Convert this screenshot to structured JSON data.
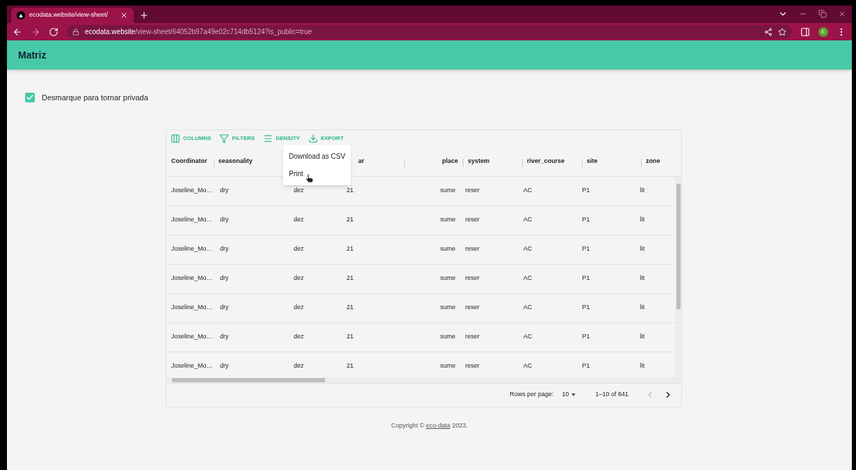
{
  "browser": {
    "tab_title": "ecodata.website/view-sheet/",
    "url_host": "ecodata.website",
    "url_path": "/view-sheet/64052b97a49e02c714db5124?is_public=true",
    "avatar": "E"
  },
  "app_bar": {
    "title": "Matriz"
  },
  "public_checkbox": {
    "label": "Desmarque para tornar privada",
    "checked": true
  },
  "toolbar": [
    {
      "kind": "columns",
      "label": "COLUMNS"
    },
    {
      "kind": "filters",
      "label": "FILTERS"
    },
    {
      "kind": "density",
      "label": "DENSITY"
    },
    {
      "kind": "export",
      "label": "EXPORT"
    }
  ],
  "table": {
    "columns": [
      {
        "label": "Coordinator",
        "kind": "leading"
      },
      {
        "label": "seasonality",
        "kind": "leading"
      },
      {
        "kind": "leading"
      },
      {
        "label": "ar",
        "kind": "leading"
      },
      {
        "label": "place",
        "kind": "trailing"
      },
      {
        "label": "system",
        "kind": "leading"
      },
      {
        "label": "river_course",
        "kind": "leading"
      },
      {
        "label": "site",
        "kind": "leading"
      },
      {
        "label": "zone",
        "kind": "leading"
      }
    ],
    "rows": [
      [
        "Joseline_Mo…",
        "dry",
        "dez",
        "21",
        "sume",
        "reser",
        "AC",
        "P1",
        "lit"
      ],
      [
        "Joseline_Mo…",
        "dry",
        "dez",
        "21",
        "sume",
        "reser",
        "AC",
        "P1",
        "lit"
      ],
      [
        "Joseline_Mo…",
        "dry",
        "dez",
        "21",
        "sume",
        "reser",
        "AC",
        "P1",
        "lit"
      ],
      [
        "Joseline_Mo…",
        "dry",
        "dez",
        "21",
        "sume",
        "reser",
        "AC",
        "P1",
        "lit"
      ],
      [
        "Joseline_Mo…",
        "dry",
        "dez",
        "21",
        "sume",
        "reser",
        "AC",
        "P1",
        "lit"
      ],
      [
        "Joseline_Mo…",
        "dry",
        "dez",
        "21",
        "sume",
        "reser",
        "AC",
        "P1",
        "lit"
      ],
      [
        "Joseline_Mo…",
        "dry",
        "dez",
        "21",
        "sume",
        "reser",
        "AC",
        "P1",
        "lit"
      ]
    ]
  },
  "export_menu": {
    "items": [
      "Download as CSV",
      "Print"
    ]
  },
  "pagination": {
    "rows_per_page_label": "Rows per page:",
    "rows_per_page": "10",
    "range": "1–10 of 841",
    "previous_disabled": true,
    "next_disabled": false
  },
  "footer": {
    "prefix": "Copyright © ",
    "link": "eco-data",
    "suffix": " 2023."
  }
}
